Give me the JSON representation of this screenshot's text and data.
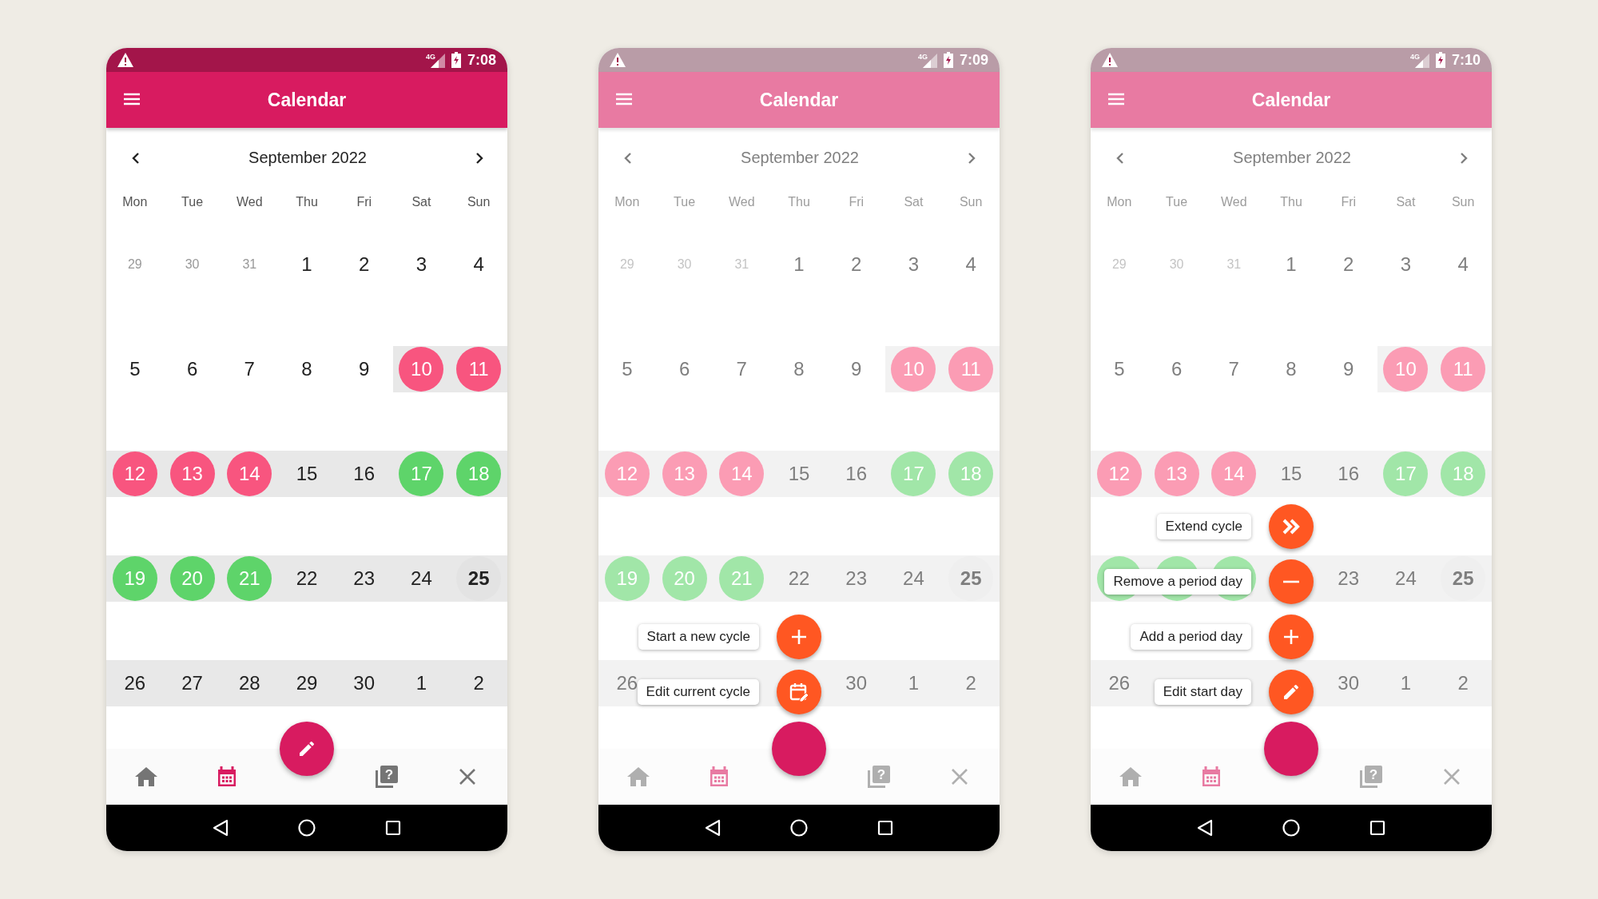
{
  "screens": [
    {
      "status_bar": {
        "network": "4G",
        "time": "7:08"
      },
      "app_bar": {
        "title": "Calendar"
      },
      "month": "September 2022",
      "dimmed": false,
      "weekdays": [
        "Mon",
        "Tue",
        "Wed",
        "Thu",
        "Fri",
        "Sat",
        "Sun"
      ],
      "weeks": [
        {
          "shaded": false,
          "days": [
            {
              "day": "29",
              "kind": "muted"
            },
            {
              "day": "30",
              "kind": "muted"
            },
            {
              "day": "31",
              "kind": "muted"
            },
            {
              "day": "1",
              "kind": "normal"
            },
            {
              "day": "2",
              "kind": "normal"
            },
            {
              "day": "3",
              "kind": "normal"
            },
            {
              "day": "4",
              "kind": "normal"
            }
          ]
        },
        {
          "shaded": false,
          "days": [
            {
              "day": "5",
              "kind": "normal",
              "shaded": false
            },
            {
              "day": "6",
              "kind": "normal",
              "shaded": false
            },
            {
              "day": "7",
              "kind": "normal",
              "shaded": false
            },
            {
              "day": "8",
              "kind": "normal",
              "shaded": false
            },
            {
              "day": "9",
              "kind": "normal",
              "shaded": false
            },
            {
              "day": "10",
              "kind": "period",
              "shaded": true
            },
            {
              "day": "11",
              "kind": "period",
              "shaded": true
            }
          ]
        },
        {
          "shaded": true,
          "days": [
            {
              "day": "12",
              "kind": "period"
            },
            {
              "day": "13",
              "kind": "period"
            },
            {
              "day": "14",
              "kind": "period"
            },
            {
              "day": "15",
              "kind": "normal"
            },
            {
              "day": "16",
              "kind": "normal"
            },
            {
              "day": "17",
              "kind": "fertile"
            },
            {
              "day": "18",
              "kind": "fertile"
            }
          ]
        },
        {
          "shaded": true,
          "days": [
            {
              "day": "19",
              "kind": "fertile"
            },
            {
              "day": "20",
              "kind": "fertile"
            },
            {
              "day": "21",
              "kind": "fertile"
            },
            {
              "day": "22",
              "kind": "normal"
            },
            {
              "day": "23",
              "kind": "normal"
            },
            {
              "day": "24",
              "kind": "normal"
            },
            {
              "day": "25",
              "kind": "today"
            }
          ]
        },
        {
          "shaded": true,
          "days": [
            {
              "day": "26",
              "kind": "normal"
            },
            {
              "day": "27",
              "kind": "normal"
            },
            {
              "day": "28",
              "kind": "normal"
            },
            {
              "day": "29",
              "kind": "normal"
            },
            {
              "day": "30",
              "kind": "normal"
            },
            {
              "day": "1",
              "kind": "normal"
            },
            {
              "day": "2",
              "kind": "normal"
            }
          ]
        }
      ],
      "nav": [
        {
          "kind": "home",
          "selected": false
        },
        {
          "kind": "calendar",
          "selected": true
        },
        {
          "kind": "help",
          "glyph": "?",
          "selected": false
        },
        {
          "kind": "close",
          "selected": false
        }
      ],
      "fab": {
        "open": false
      }
    },
    {
      "status_bar": {
        "network": "4G",
        "time": "7:09"
      },
      "app_bar": {
        "title": "Calendar"
      },
      "month": "September 2022",
      "dimmed": true,
      "weekdays": [
        "Mon",
        "Tue",
        "Wed",
        "Thu",
        "Fri",
        "Sat",
        "Sun"
      ],
      "weeks": [
        {
          "shaded": false,
          "days": [
            {
              "day": "29",
              "kind": "muted"
            },
            {
              "day": "30",
              "kind": "muted"
            },
            {
              "day": "31",
              "kind": "muted"
            },
            {
              "day": "1",
              "kind": "normal"
            },
            {
              "day": "2",
              "kind": "normal"
            },
            {
              "day": "3",
              "kind": "normal"
            },
            {
              "day": "4",
              "kind": "normal"
            }
          ]
        },
        {
          "shaded": false,
          "days": [
            {
              "day": "5",
              "kind": "normal",
              "shaded": false
            },
            {
              "day": "6",
              "kind": "normal",
              "shaded": false
            },
            {
              "day": "7",
              "kind": "normal",
              "shaded": false
            },
            {
              "day": "8",
              "kind": "normal",
              "shaded": false
            },
            {
              "day": "9",
              "kind": "normal",
              "shaded": false
            },
            {
              "day": "10",
              "kind": "period",
              "shaded": true
            },
            {
              "day": "11",
              "kind": "period",
              "shaded": true
            }
          ]
        },
        {
          "shaded": true,
          "days": [
            {
              "day": "12",
              "kind": "period"
            },
            {
              "day": "13",
              "kind": "period"
            },
            {
              "day": "14",
              "kind": "period"
            },
            {
              "day": "15",
              "kind": "normal"
            },
            {
              "day": "16",
              "kind": "normal"
            },
            {
              "day": "17",
              "kind": "fertile"
            },
            {
              "day": "18",
              "kind": "fertile"
            }
          ]
        },
        {
          "shaded": true,
          "days": [
            {
              "day": "19",
              "kind": "fertile"
            },
            {
              "day": "20",
              "kind": "fertile"
            },
            {
              "day": "21",
              "kind": "fertile"
            },
            {
              "day": "22",
              "kind": "normal"
            },
            {
              "day": "23",
              "kind": "normal"
            },
            {
              "day": "24",
              "kind": "normal"
            },
            {
              "day": "25",
              "kind": "today"
            }
          ]
        },
        {
          "shaded": true,
          "days": [
            {
              "day": "26",
              "kind": "normal"
            },
            {
              "kind": "normal"
            },
            {
              "kind": "normal"
            },
            {
              "kind": "normal"
            },
            {
              "day": "30",
              "kind": "normal"
            },
            {
              "day": "1",
              "kind": "normal"
            },
            {
              "day": "2",
              "kind": "normal"
            }
          ]
        }
      ],
      "nav": [
        {
          "kind": "home",
          "selected": false
        },
        {
          "kind": "calendar",
          "selected": true
        },
        {
          "kind": "help",
          "glyph": "?",
          "selected": false
        },
        {
          "kind": "close",
          "selected": false
        }
      ],
      "fab": {
        "open": true
      },
      "menu": [
        {
          "label": "Start a new cycle",
          "kind": "plus"
        },
        {
          "label": "Edit current cycle",
          "kind": "calendar-edit"
        }
      ]
    },
    {
      "status_bar": {
        "network": "4G",
        "time": "7:10"
      },
      "app_bar": {
        "title": "Calendar"
      },
      "month": "September 2022",
      "dimmed": true,
      "weekdays": [
        "Mon",
        "Tue",
        "Wed",
        "Thu",
        "Fri",
        "Sat",
        "Sun"
      ],
      "weeks": [
        {
          "shaded": false,
          "days": [
            {
              "day": "29",
              "kind": "muted"
            },
            {
              "day": "30",
              "kind": "muted"
            },
            {
              "day": "31",
              "kind": "muted"
            },
            {
              "day": "1",
              "kind": "normal"
            },
            {
              "day": "2",
              "kind": "normal"
            },
            {
              "day": "3",
              "kind": "normal"
            },
            {
              "day": "4",
              "kind": "normal"
            }
          ]
        },
        {
          "shaded": false,
          "days": [
            {
              "day": "5",
              "kind": "normal",
              "shaded": false
            },
            {
              "day": "6",
              "kind": "normal",
              "shaded": false
            },
            {
              "day": "7",
              "kind": "normal",
              "shaded": false
            },
            {
              "day": "8",
              "kind": "normal",
              "shaded": false
            },
            {
              "day": "9",
              "kind": "normal",
              "shaded": false
            },
            {
              "day": "10",
              "kind": "period",
              "shaded": true
            },
            {
              "day": "11",
              "kind": "period",
              "shaded": true
            }
          ]
        },
        {
          "shaded": true,
          "days": [
            {
              "day": "12",
              "kind": "period"
            },
            {
              "day": "13",
              "kind": "period"
            },
            {
              "day": "14",
              "kind": "period"
            },
            {
              "day": "15",
              "kind": "normal"
            },
            {
              "day": "16",
              "kind": "normal"
            },
            {
              "day": "17",
              "kind": "fertile"
            },
            {
              "day": "18",
              "kind": "fertile"
            }
          ]
        },
        {
          "shaded": true,
          "days": [
            {
              "kind": "fertile"
            },
            {
              "kind": "fertile"
            },
            {
              "kind": "fertile"
            },
            {
              "kind": "normal"
            },
            {
              "day": "23",
              "kind": "normal"
            },
            {
              "day": "24",
              "kind": "normal"
            },
            {
              "day": "25",
              "kind": "today"
            }
          ]
        },
        {
          "shaded": true,
          "days": [
            {
              "day": "26",
              "kind": "normal"
            },
            {
              "kind": "normal"
            },
            {
              "kind": "normal"
            },
            {
              "kind": "normal"
            },
            {
              "day": "30",
              "kind": "normal"
            },
            {
              "day": "1",
              "kind": "normal"
            },
            {
              "day": "2",
              "kind": "normal"
            }
          ]
        }
      ],
      "nav": [
        {
          "kind": "home",
          "selected": false
        },
        {
          "kind": "calendar",
          "selected": true
        },
        {
          "kind": "help",
          "glyph": "?",
          "selected": false
        },
        {
          "kind": "close",
          "selected": false
        }
      ],
      "fab": {
        "open": true
      },
      "menu": [
        {
          "label": "Extend cycle",
          "kind": "forward"
        },
        {
          "label": "Remove a period day",
          "kind": "minus"
        },
        {
          "label": "Add a period day",
          "kind": "plus"
        },
        {
          "label": "Edit start day",
          "kind": "pencil"
        }
      ]
    }
  ]
}
